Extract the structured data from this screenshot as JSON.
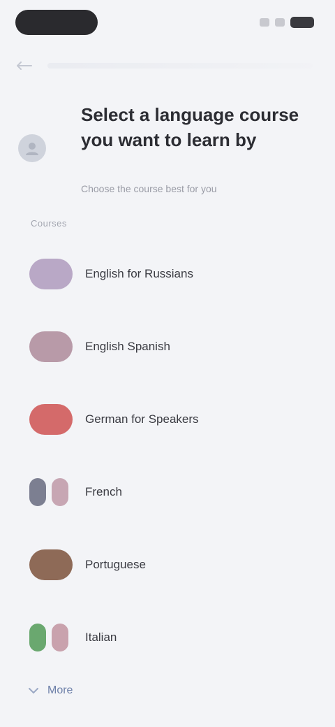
{
  "header": {
    "title": "Select a language course you want to learn by",
    "subtitle": "Choose the course best for you"
  },
  "section_label": "Courses",
  "courses": [
    {
      "label": "English for Russians",
      "color": "#b9a8c6",
      "icon": "flag-icon"
    },
    {
      "label": "English Spanish",
      "color": "#b89aa8",
      "icon": "flag-icon"
    },
    {
      "label": "German for Speakers",
      "color": "#d46a6a",
      "icon": "flag-icon"
    },
    {
      "label": "French",
      "color_left": "#7c7f91",
      "color_right": "#c7a6b3",
      "icon": "flag-icon"
    },
    {
      "label": "Portuguese",
      "color": "#8e6a57",
      "icon": "flag-icon"
    },
    {
      "label": "Italian",
      "color_left": "#6aa86f",
      "color_right": "#c9a2ad",
      "icon": "flag-icon"
    }
  ],
  "more_label": "More"
}
